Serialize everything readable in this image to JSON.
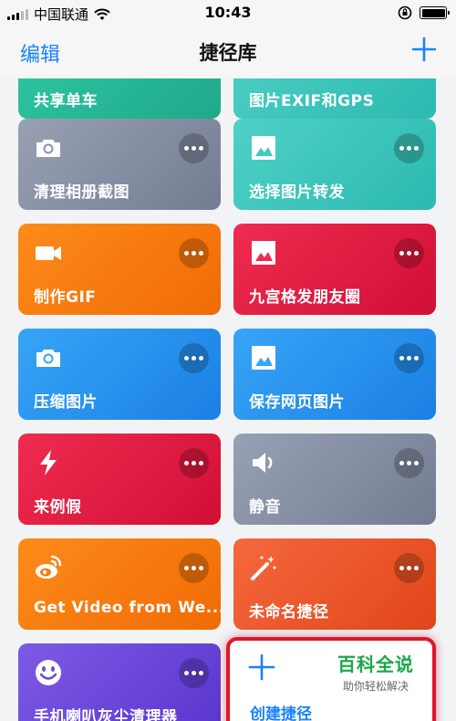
{
  "status_bar": {
    "carrier": "中国联通",
    "time": "10:43",
    "battery_level": 1.0
  },
  "nav": {
    "edit": "编辑",
    "title": "捷径库",
    "add_icon": "plus-icon"
  },
  "shortcuts": [
    {
      "label": "共享单车",
      "color": "#2fc8a3",
      "icon": "bike-icon"
    },
    {
      "label": "图片EXIF和GPS",
      "color": "#4ed1c6",
      "icon": "photo-icon"
    },
    {
      "label": "清理相册截图",
      "color": "#8a93a8",
      "icon": "camera-icon"
    },
    {
      "label": "选择图片转发",
      "color": "#3ecbc1",
      "icon": "photo-icon"
    },
    {
      "label": "制作GIF",
      "color": "#fd8b1a",
      "icon": "video-camera-icon"
    },
    {
      "label": "九宫格发朋友圈",
      "color": "#ef2c4f",
      "icon": "photo-icon"
    },
    {
      "label": "压缩图片",
      "color": "#37a5f6",
      "icon": "camera-icon"
    },
    {
      "label": "保存网页图片",
      "color": "#37a5f6",
      "icon": "photo-icon"
    },
    {
      "label": "来例假",
      "color": "#ef2c4f",
      "icon": "lightning-icon"
    },
    {
      "label": "静音",
      "color": "#8a93a8",
      "icon": "speaker-icon"
    },
    {
      "label": "Get Video from We...",
      "color": "#fd8b1a",
      "icon": "weibo-icon"
    },
    {
      "label": "未命名捷径",
      "color": "#f5683d",
      "icon": "magic-wand-icon"
    },
    {
      "label": "手机喇叭灰尘清理器",
      "color": "#7d5ae6",
      "icon": "smiley-icon"
    }
  ],
  "create": {
    "label": "创建捷径",
    "icon": "plus-icon"
  },
  "watermark": {
    "title": "百科全说",
    "subtitle": "助你轻松解决"
  }
}
